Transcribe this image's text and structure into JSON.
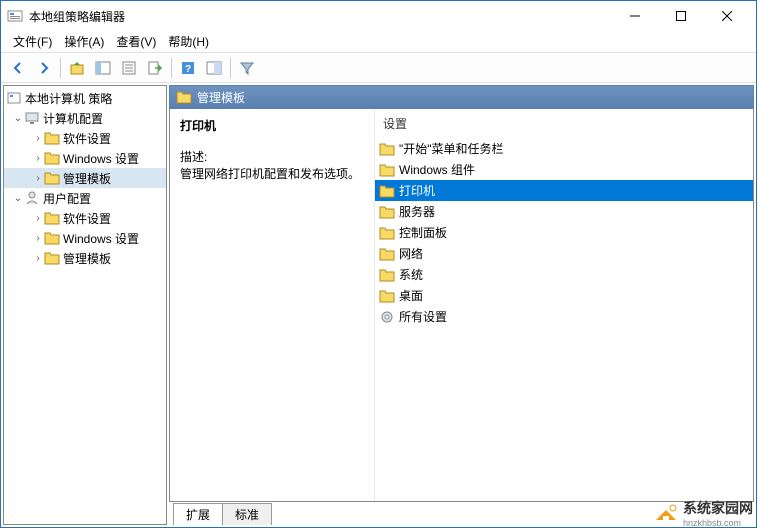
{
  "window": {
    "title": "本地组策略编辑器"
  },
  "menu": {
    "file": "文件(F)",
    "action": "操作(A)",
    "view": "查看(V)",
    "help": "帮助(H)"
  },
  "tree": {
    "root": "本地计算机 策略",
    "computer": "计算机配置",
    "computer_children": {
      "software": "软件设置",
      "windows": "Windows 设置",
      "admin": "管理模板"
    },
    "user": "用户配置",
    "user_children": {
      "software": "软件设置",
      "windows": "Windows 设置",
      "admin": "管理模板"
    }
  },
  "right": {
    "header": "管理模板",
    "selected_title": "打印机",
    "desc_label": "描述:",
    "desc_text": "管理网络打印机配置和发布选项。"
  },
  "settings": {
    "header": "设置",
    "items": [
      "\"开始\"菜单和任务栏",
      "Windows 组件",
      "打印机",
      "服务器",
      "控制面板",
      "网络",
      "系统",
      "桌面",
      "所有设置"
    ],
    "selected_index": 2
  },
  "tabs": {
    "extended": "扩展",
    "standard": "标准"
  },
  "watermark": {
    "name": "系统家园网",
    "url": "hnzkhbsb.com"
  }
}
